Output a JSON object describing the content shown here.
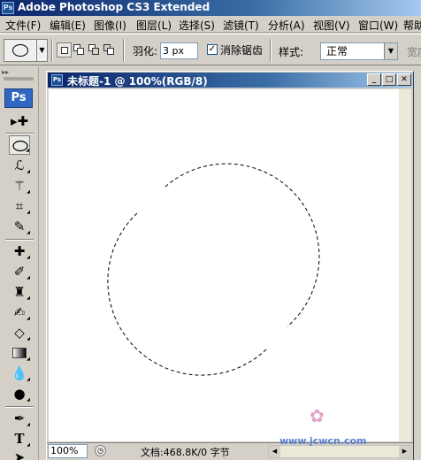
{
  "app": {
    "title": "Adobe Photoshop CS3 Extended",
    "logo": "Ps"
  },
  "menu": [
    "文件(F)",
    "编辑(E)",
    "图像(I)",
    "图层(L)",
    "选择(S)",
    "滤镜(T)",
    "分析(A)",
    "视图(V)",
    "窗口(W)",
    "帮助"
  ],
  "options": {
    "feather_label": "羽化:",
    "feather_value": "3 px",
    "antialias_checked": true,
    "antialias_label": "消除锯齿",
    "style_label": "样式:",
    "style_value": "正常",
    "width_label": "宽度"
  },
  "tools": {
    "logo": "Ps",
    "items": [
      "move-tool",
      "elliptical-marquee-tool",
      "lasso-tool",
      "magic-wand-tool",
      "crop-tool",
      "eyedropper-tool",
      "healing-brush-tool",
      "brush-tool",
      "clone-stamp-tool",
      "history-brush-tool",
      "eraser-tool",
      "gradient-tool",
      "blur-tool",
      "dodge-tool",
      "pen-tool",
      "type-tool",
      "path-selection-tool"
    ]
  },
  "document": {
    "title": "未标题-1 @ 100%(RGB/8)",
    "zoom": "100%",
    "status": "文档:468.8K/0 字节"
  },
  "watermark": "www.jcwcn.com"
}
